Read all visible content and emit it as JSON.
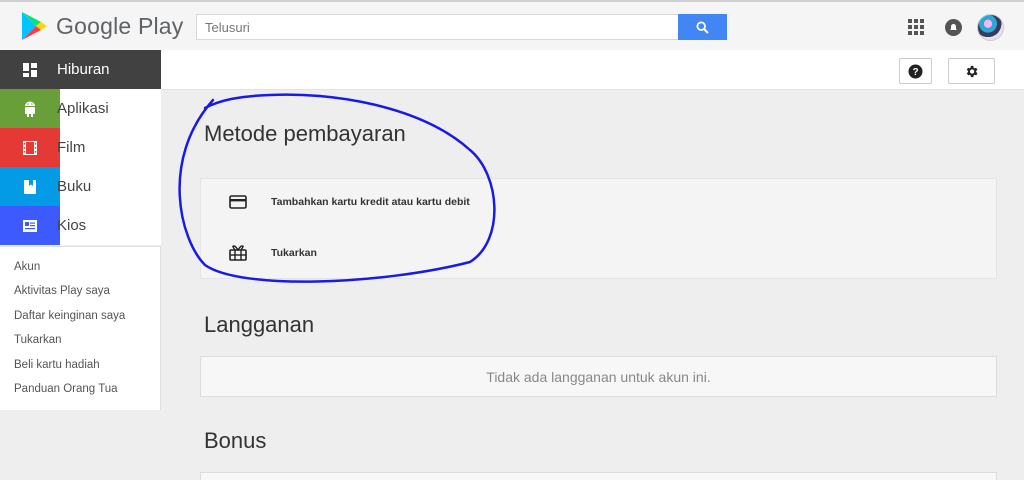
{
  "header": {
    "logo_text": "Google Play",
    "search_placeholder": "Telusuri",
    "search_icon": "search-icon",
    "apps_icon": "apps-grid-icon",
    "notification_icon": "notification-bell-icon",
    "avatar": "user-avatar"
  },
  "toolbar": {
    "help_icon": "help-icon",
    "settings_icon": "gear-icon"
  },
  "sidebar": {
    "items": [
      {
        "label": "Hiburan",
        "icon": "entertainment-grid-icon",
        "active": true
      },
      {
        "label": "Aplikasi",
        "icon": "android-icon",
        "color": "#689f38"
      },
      {
        "label": "Film",
        "icon": "film-icon",
        "color": "#e53935"
      },
      {
        "label": "Buku",
        "icon": "book-icon",
        "color": "#039be5"
      },
      {
        "label": "Kios",
        "icon": "newsstand-icon",
        "color": "#3d5afe"
      }
    ],
    "links": [
      "Akun",
      "Aktivitas Play saya",
      "Daftar keinginan saya",
      "Tukarkan",
      "Beli kartu hadiah",
      "Panduan Orang Tua"
    ]
  },
  "main": {
    "payment": {
      "title": "Metode pembayaran",
      "options": [
        {
          "label": "Tambahkan kartu kredit atau kartu debit",
          "icon": "credit-card-icon"
        },
        {
          "label": "Tukarkan",
          "icon": "gift-card-icon"
        }
      ]
    },
    "subscriptions": {
      "title": "Langganan",
      "empty_text": "Tidak ada langganan untuk akun ini."
    },
    "bonus": {
      "title": "Bonus"
    }
  },
  "colors": {
    "search_button": "#4285f4",
    "active_nav": "#414141",
    "annotation": "#1a1ae6"
  }
}
